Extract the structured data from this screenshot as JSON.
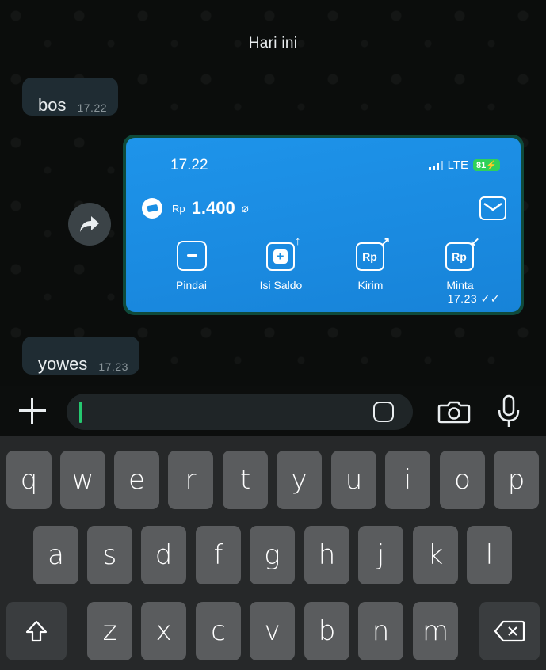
{
  "chat": {
    "date_label": "Hari ini",
    "messages": [
      {
        "text": "bos",
        "time": "17.22"
      },
      {
        "text": "yowes",
        "time": "17.23"
      }
    ],
    "image_message": {
      "time": "17.23 ✓✓",
      "screenshot": {
        "status_time": "17.22",
        "network": "LTE",
        "battery": "81",
        "currency": "Rp",
        "balance": "1.400",
        "actions": [
          "Pindai",
          "Isi Saldo",
          "Kirim",
          "Minta"
        ],
        "rp_label": "Rp"
      }
    }
  },
  "input": {
    "placeholder": ""
  },
  "keyboard": {
    "row1": [
      "q",
      "w",
      "e",
      "r",
      "t",
      "y",
      "u",
      "i",
      "o",
      "p"
    ],
    "row2": [
      "a",
      "s",
      "d",
      "f",
      "g",
      "h",
      "j",
      "k",
      "l"
    ],
    "row3": [
      "z",
      "x",
      "c",
      "v",
      "b",
      "n",
      "m"
    ]
  }
}
